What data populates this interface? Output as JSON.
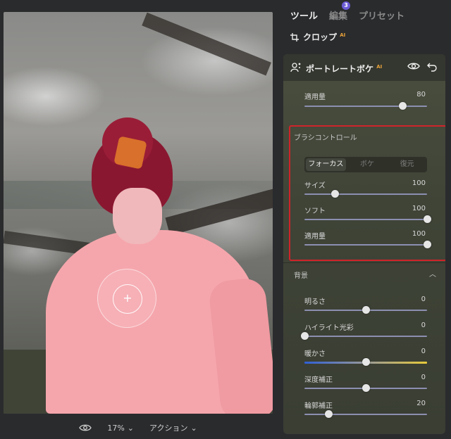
{
  "tabs": [
    {
      "label": "ツール",
      "active": true
    },
    {
      "label": "編集",
      "badge": "3"
    },
    {
      "label": "プリセット"
    }
  ],
  "crop": {
    "label": "クロップ",
    "ai": "AI"
  },
  "portrait_bokeh": {
    "title": "ポートレートボケ",
    "ai": "AI",
    "amount": {
      "label": "適用量",
      "value": "80",
      "level": 0.8
    }
  },
  "brush_control": {
    "title": "ブラシコントロール",
    "modes": [
      "フォーカス",
      "ボケ",
      "復元"
    ],
    "active_mode": "フォーカス",
    "sliders": [
      {
        "label": "サイズ",
        "value": "100",
        "level": 0.25
      },
      {
        "label": "ソフト",
        "value": "100",
        "level": 1.0
      },
      {
        "label": "適用量",
        "value": "100",
        "level": 1.0
      }
    ]
  },
  "background": {
    "title": "背景",
    "sliders": [
      {
        "label": "明るさ",
        "value": "0",
        "level": 0.5
      },
      {
        "label": "ハイライト光彩",
        "value": "0",
        "level": 0.0
      },
      {
        "label": "暖かさ",
        "value": "0",
        "level": 0.5,
        "track": "temperature"
      },
      {
        "label": "深度補正",
        "value": "0",
        "level": 0.5
      },
      {
        "label": "輪郭補正",
        "value": "20",
        "level": 0.2
      }
    ]
  },
  "bottom_bar": {
    "zoom": "17%",
    "actions": "アクション"
  },
  "colors": {
    "accent_red": "#d0232a",
    "badge": "#6b5bd6",
    "ai_tag": "#e8a23a"
  },
  "icons": [
    "eye-icon",
    "crop-icon",
    "portrait-icon",
    "undo-icon",
    "chevron-down-icon",
    "chevron-up-icon"
  ]
}
